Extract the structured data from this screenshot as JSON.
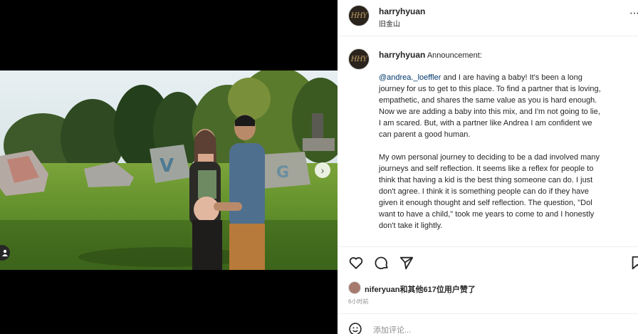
{
  "post": {
    "username": "harryhyuan",
    "location": "旧金山",
    "avatar_text": "HHY"
  },
  "caption": {
    "username": "harryhyuan",
    "intro": "Announcement:",
    "mention": "@andrea._loeffler",
    "p1_first_rest": " and I are having a baby! It's been a long",
    "p1_lines": [
      "journey for us to get to this place. To find a partner that is loving,",
      "empathetic, and shares the same value as you is hard enough.",
      "Now we are adding a baby into this mix, and I'm not going to lie,",
      "I am scared. But, with a partner like Andrea I am confident we",
      "can parent a good human."
    ],
    "p2_lines": [
      "My own personal journey to deciding to be a dad involved many",
      "journeys and self reflection. It seems like a reflex for people to",
      "think that having a kid is the best thing someone can do. I just",
      "don't agree. I think it is something people can do if they have",
      "given it enough thought and self reflection. The question, \"Dol",
      "want to have a child,\" took me years to come to and I honestly",
      "don't take it lightly."
    ]
  },
  "likes": {
    "text": "niferyuan和其他617位用户赞了"
  },
  "timestamp": "6小时前",
  "comment": {
    "placeholder": "添加评论..."
  },
  "icons": {
    "like": "heart-icon",
    "comment": "comment-icon",
    "share": "send-icon",
    "save": "bookmark-icon",
    "more": "more-icon",
    "next": "chevron-right-icon",
    "tags": "user-tag-icon",
    "emoji": "emoji-icon"
  }
}
